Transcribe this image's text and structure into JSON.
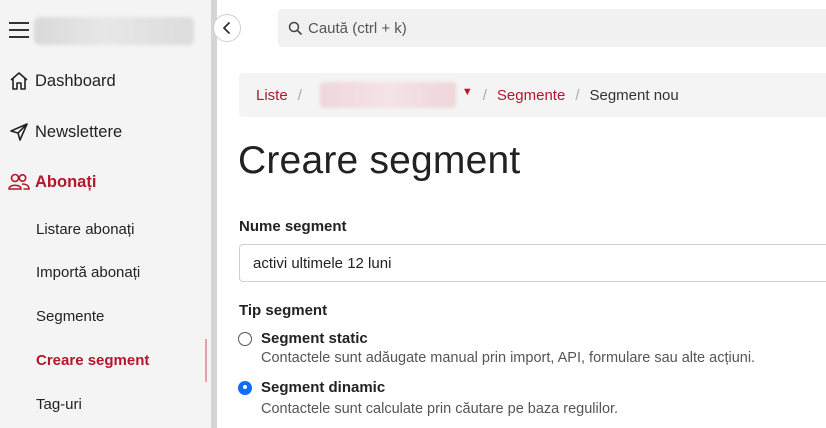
{
  "sidebar": {
    "nav": [
      {
        "label": "Dashboard",
        "icon": "home-icon"
      },
      {
        "label": "Newslettere",
        "icon": "send-icon"
      },
      {
        "label": "Abonați",
        "icon": "users-icon"
      }
    ],
    "sub_items": [
      {
        "label": "Listare abonați"
      },
      {
        "label": "Importă abonați"
      },
      {
        "label": "Segmente"
      },
      {
        "label": "Creare segment"
      },
      {
        "label": "Tag-uri"
      }
    ]
  },
  "search": {
    "placeholder": "Caută (ctrl + k)"
  },
  "breadcrumb": {
    "liste": "Liste",
    "segmente": "Segmente",
    "current": "Segment nou"
  },
  "page": {
    "title": "Creare segment"
  },
  "form": {
    "name_label": "Nume segment",
    "name_value": "activi ultimele 12 luni",
    "type_label": "Tip segment",
    "options": [
      {
        "title": "Segment static",
        "desc": "Contactele sunt adăugate manual prin import, API, formulare sau alte acțiuni.",
        "checked": false
      },
      {
        "title": "Segment dinamic",
        "desc": "Contactele sunt calculate prin căutare pe baza regulilor.",
        "checked": true
      }
    ]
  },
  "colors": {
    "accent": "#b4162b",
    "radio_checked": "#0d6efd"
  }
}
